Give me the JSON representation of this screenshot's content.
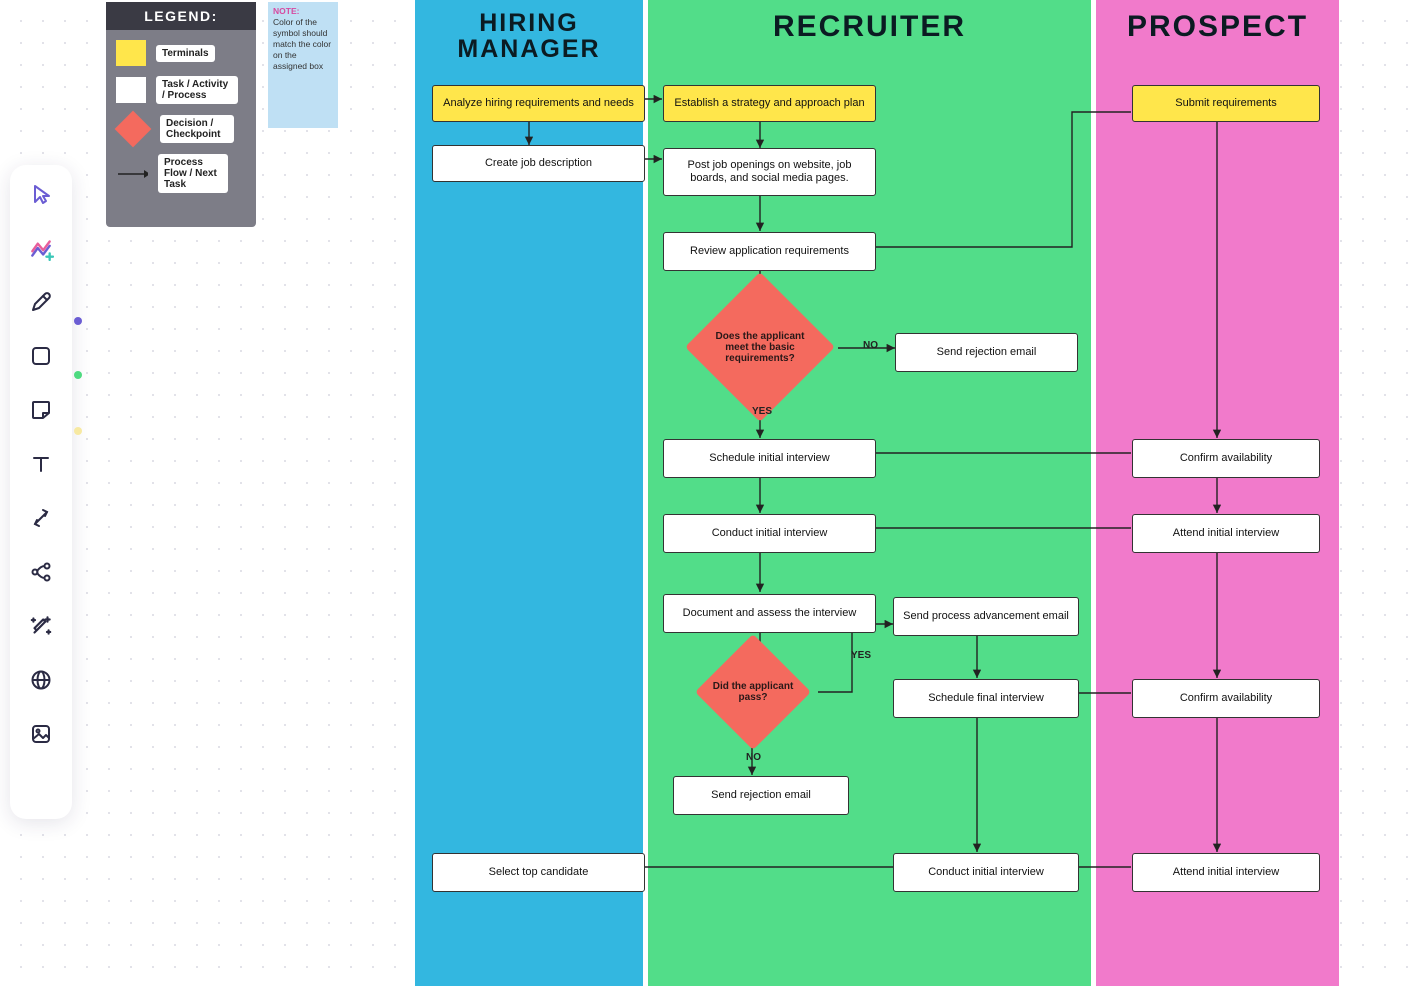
{
  "legend": {
    "title": "LEGEND:",
    "terminals": "Terminals",
    "task": "Task / Activity / Process",
    "decision": "Decision / Checkpoint",
    "flow": "Process Flow / Next Task"
  },
  "note": {
    "title": "NOTE:",
    "body": "Color of the symbol should match the color on the assigned box"
  },
  "lanes": {
    "hm": "HIRING MANAGER",
    "rc": "RECRUITER",
    "pr": "PROSPECT"
  },
  "nodes": {
    "hm_analyze": "Analyze hiring requirements and needs",
    "hm_create": "Create job description",
    "rc_strategy": "Establish a strategy and approach plan",
    "rc_post": "Post job openings on website, job boards, and social media pages.",
    "rc_review": "Review application requirements",
    "rc_dec1": "Does the applicant meet the basic requirements?",
    "rc_reject1": "Send rejection email",
    "rc_sched_init": "Schedule initial interview",
    "rc_conduct_init": "Conduct initial interview",
    "rc_doc": "Document and assess the interview",
    "rc_dec2": "Did the applicant pass?",
    "rc_advance": "Send process advancement email",
    "rc_sched_final": "Schedule final interview",
    "rc_reject2": "Send rejection email",
    "rc_conduct2": "Conduct initial interview",
    "hm_select": "Select top candidate",
    "pr_submit": "Submit requirements",
    "pr_confirm1": "Confirm availability",
    "pr_attend1": "Attend initial interview",
    "pr_confirm2": "Confirm availability",
    "pr_attend2": "Attend initial interview"
  },
  "labels": {
    "yes": "YES",
    "no": "NO"
  },
  "tools": {
    "select": "select",
    "ai": "ai-assist",
    "pen": "pen",
    "shape": "shape",
    "sticky": "sticky-note",
    "text": "text",
    "connector": "connector",
    "mindmap": "mind-map",
    "effects": "effects",
    "widget": "widget",
    "image": "image"
  }
}
